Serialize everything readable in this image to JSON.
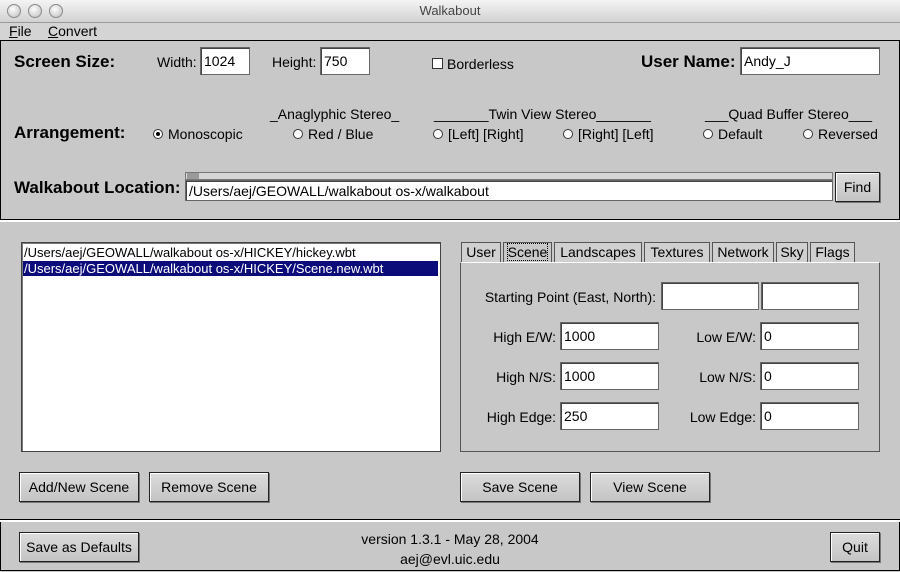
{
  "window": {
    "title": "Walkabout"
  },
  "menu": {
    "file": "File",
    "file_ul": "F",
    "file_rest": "ile",
    "convert": "Convert",
    "convert_ul": "C",
    "convert_rest": "onvert"
  },
  "screen": {
    "label": "Screen Size:",
    "width_label": "Width:",
    "width_value": "1024",
    "height_label": "Height:",
    "height_value": "750",
    "borderless_label": "Borderless",
    "borderless_checked": false,
    "user_label": "User Name:",
    "user_value": "Andy_J"
  },
  "arrangement": {
    "label": "Arrangement:",
    "anaglyphic_header": "_Anaglyphic Stereo_",
    "twinview_header": "_______Twin View Stereo_______",
    "quadbuffer_header": "___Quad Buffer Stereo___",
    "options": [
      "Monoscopic",
      "Red / Blue",
      "[Left] [Right]",
      "[Right] [Left]",
      "Default",
      "Reversed"
    ],
    "selected": "Monoscopic"
  },
  "location": {
    "label": "Walkabout Location:",
    "path": "/Users/aej/GEOWALL/walkabout os-x/walkabout",
    "find_label": "Find"
  },
  "scenes": {
    "items": [
      "/Users/aej/GEOWALL/walkabout os-x/HICKEY/hickey.wbt",
      "/Users/aej/GEOWALL/walkabout os-x/HICKEY/Scene.new.wbt"
    ],
    "selected_index": 1,
    "add_label": "Add/New Scene",
    "remove_label": "Remove Scene"
  },
  "tabs": {
    "items": [
      "User",
      "Scene",
      "Landscapes",
      "Textures",
      "Network",
      "Sky",
      "Flags"
    ],
    "active": "Scene"
  },
  "scene_form": {
    "starting_point_label": "Starting Point (East, North):",
    "starting_east": "",
    "starting_north": "",
    "high_ew_label": "High E/W:",
    "high_ew": "1000",
    "low_ew_label": "Low E/W:",
    "low_ew": "0",
    "high_ns_label": "High N/S:",
    "high_ns": "1000",
    "low_ns_label": "Low N/S:",
    "low_ns": "0",
    "high_edge_label": "High Edge:",
    "high_edge": "250",
    "low_edge_label": "Low Edge:",
    "low_edge": "0",
    "save_label": "Save Scene",
    "view_label": "View Scene"
  },
  "footer": {
    "save_defaults_label": "Save as Defaults",
    "version": "version 1.3.1 - May 28, 2004",
    "email": "aej@evl.uic.edu",
    "quit_label": "Quit"
  }
}
